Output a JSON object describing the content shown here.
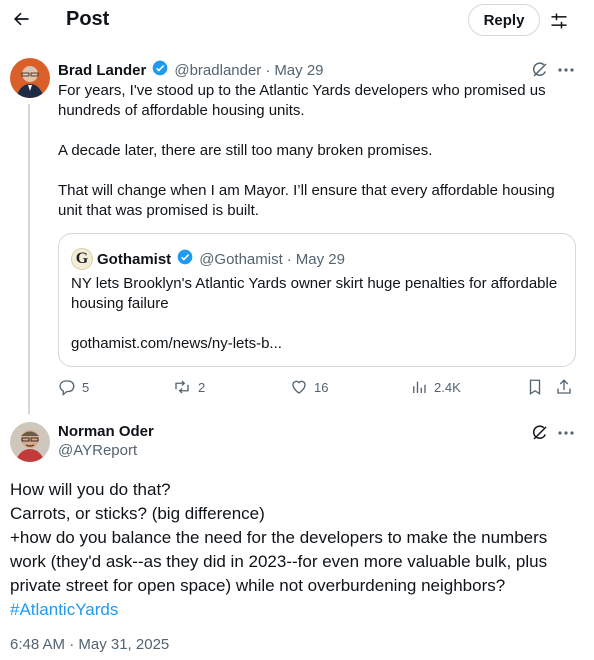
{
  "header": {
    "title": "Post",
    "reply_label": "Reply"
  },
  "tweet": {
    "author_name": "Brad Lander",
    "handle": "@bradlander",
    "separator": "·",
    "date": "May 29",
    "paragraphs": [
      "For years, I've stood up to the Atlantic Yards developers who promised us hundreds of affordable housing units.",
      "A decade later, there are still too many broken promises.",
      "That will change when I am Mayor. I’ll ensure that every affordable housing unit that was promised is built."
    ],
    "quote": {
      "author_name": "Gothamist",
      "logo_letter": "G",
      "handle": "@Gothamist",
      "separator": "·",
      "date": "May 29",
      "text": "NY lets Brooklyn's Atlantic Yards owner skirt huge penalties for affordable housing failure",
      "link": "gothamist.com/news/ny-lets-b..."
    },
    "actions": {
      "replies": "5",
      "reposts": "2",
      "likes": "16",
      "views": "2.4K"
    }
  },
  "reply": {
    "author_name": "Norman Oder",
    "handle": "@AYReport",
    "lines": [
      "How will you do that?",
      "Carrots, or sticks? (big difference)",
      "+how do you balance the need for the developers to make the numbers work (they'd ask--as they did in 2023--for even more valuable bulk, plus private street for open space) while not overburdening neighbors?"
    ],
    "hashtag": "#AtlanticYards",
    "timestamp": "6:48 AM · May 31, 2025"
  },
  "colors": {
    "accent": "#1d9bf0",
    "secondary_text": "#536471",
    "border": "#cfd9de"
  }
}
